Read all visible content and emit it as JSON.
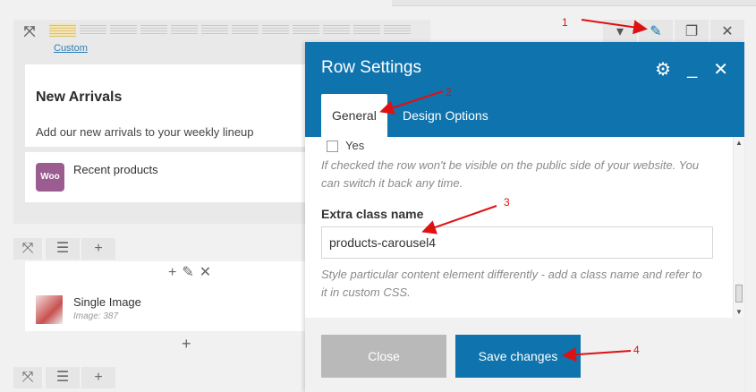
{
  "builder": {
    "custom_link": "Custom",
    "new_arrivals_title": "New Arrivals",
    "new_arrivals_sub": "Add our new arrivals to your weekly lineup",
    "woo_badge": "Woo",
    "recent_products": "Recent products",
    "single_image_title": "Single Image",
    "single_image_meta": "Image: 387"
  },
  "modal": {
    "title": "Row Settings",
    "tabs": [
      "General",
      "Design Options"
    ],
    "checkbox_label": "Yes",
    "hidden_help": "If checked the row won't be visible on the public side of your website. You can switch it back any time.",
    "extra_class_label": "Extra class name",
    "extra_class_value": "products-carousel4",
    "extra_class_help": "Style particular content element differently - add a class name and refer to it in custom CSS.",
    "close_label": "Close",
    "save_label": "Save changes"
  },
  "annotations": [
    "1",
    "2",
    "3",
    "4"
  ],
  "colors": {
    "accent": "#0f73ad",
    "woo": "#9b5c8f",
    "arrow": "#dd1111"
  }
}
